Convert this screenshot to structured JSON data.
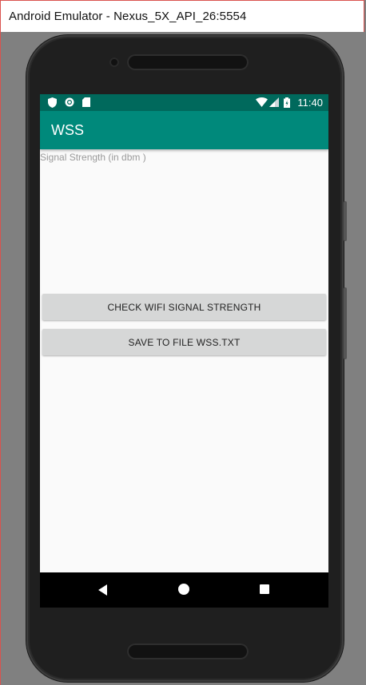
{
  "window": {
    "title": "Android Emulator - Nexus_5X_API_26:5554"
  },
  "statusbar": {
    "left_icons": [
      "shield-icon",
      "circle-icon",
      "sd-card-icon"
    ],
    "right_icons": [
      "wifi-icon",
      "cell-signal-icon",
      "battery-icon"
    ],
    "time": "11:40"
  },
  "app": {
    "title": "WSS",
    "signal_label": "Signal Strength (in dbm )",
    "check_button_label": "CHECK WIFI SIGNAL STRENGTH",
    "save_button_label": "SAVE TO FILE WSS.TXT"
  },
  "navbar": {
    "icons": [
      "back-icon",
      "home-icon",
      "recents-icon"
    ]
  },
  "colors": {
    "statusbar": "#00695c",
    "appbar": "#00897b",
    "button": "#d6d7d7"
  }
}
